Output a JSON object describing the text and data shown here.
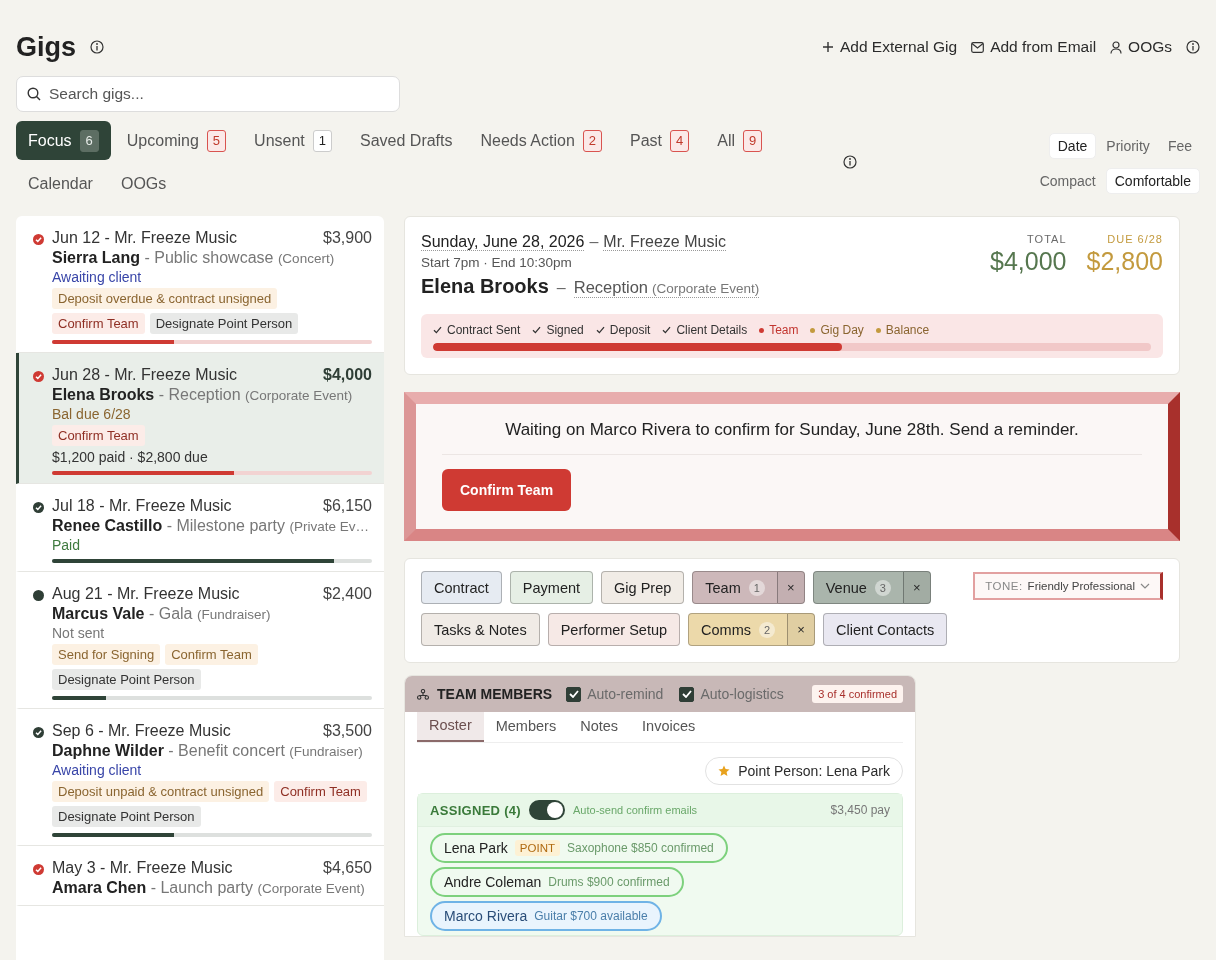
{
  "header": {
    "title": "Gigs",
    "actions": [
      {
        "kind": "add",
        "label": "Add External Gig"
      },
      {
        "kind": "email",
        "label": "Add from Email"
      },
      {
        "kind": "person",
        "label": "OOGs"
      }
    ]
  },
  "search": {
    "placeholder": "Search gigs..."
  },
  "tabs": [
    {
      "label": "Focus",
      "count": {
        "text": "6",
        "kind": "plain"
      },
      "selected": true
    },
    {
      "label": "Upcoming",
      "count": {
        "text": "5",
        "kind": "alert"
      },
      "selected": false
    },
    {
      "label": "Unsent",
      "count": {
        "text": "1",
        "kind": "plain"
      },
      "selected": false
    },
    {
      "label": "Saved Drafts",
      "selected": false
    },
    {
      "label": "Needs Action",
      "count": {
        "text": "2",
        "kind": "alert"
      },
      "selected": false
    },
    {
      "label": "Past",
      "count": {
        "text": "4",
        "kind": "alert"
      },
      "selected": false
    },
    {
      "label": "All",
      "count": {
        "text": "9",
        "kind": "alert"
      },
      "selected": false
    },
    {
      "label": "Calendar",
      "selected": false
    },
    {
      "label": "OOGs",
      "selected": false
    }
  ],
  "sort": [
    {
      "label": "Date",
      "selected": true
    },
    {
      "label": "Priority",
      "selected": false
    },
    {
      "label": "Fee",
      "selected": false
    }
  ],
  "density": [
    {
      "label": "Compact",
      "selected": false
    },
    {
      "label": "Comfortable",
      "selected": true
    }
  ],
  "gigs": [
    {
      "kind": "alert",
      "heading": "Jun 12 - Mr. Freeze Music",
      "amount": "$3,900",
      "name": "Sierra Lang",
      "event": "- Public showcase",
      "category": "(Concert)",
      "status": {
        "text": "Awaiting client",
        "kind": "awaiting"
      },
      "tags": [
        {
          "label": "Deposit overdue & contract unsigned",
          "kind": "warn"
        },
        {
          "label": "Confirm Team",
          "kind": "danger"
        },
        {
          "label": "Designate Point Person",
          "kind": "neutral"
        }
      ],
      "level": 0.38,
      "selected": false
    },
    {
      "kind": "alert",
      "heading": "Jun 28 - Mr. Freeze Music",
      "amount": "$4,000",
      "name": "Elena Brooks",
      "event": "- Reception",
      "category": "(Corporate Event)",
      "status": {
        "text": "Bal due 6/28",
        "kind": "due"
      },
      "tags": [
        {
          "label": "Confirm Team",
          "kind": "danger"
        }
      ],
      "note": "$1,200 paid · $2,800 due",
      "level": 0.57,
      "selected": true
    },
    {
      "kind": "ok",
      "heading": "Jul 18 - Mr. Freeze Music",
      "amount": "$6,150",
      "name": "Renee Castillo",
      "event": "- Milestone party",
      "category": "(Private Ev…",
      "status": {
        "text": "Paid",
        "kind": "paid"
      },
      "level": 0.88,
      "selected": false
    },
    {
      "kind": "idle",
      "heading": "Aug 21 - Mr. Freeze Music",
      "amount": "$2,400",
      "name": "Marcus Vale",
      "event": "- Gala",
      "category": "(Fundraiser)",
      "status": {
        "text": "Not sent",
        "kind": "muted"
      },
      "tags": [
        {
          "label": "Send for Signing",
          "kind": "warn"
        },
        {
          "label": "Confirm Team",
          "kind": "warn"
        },
        {
          "label": "Designate Point Person",
          "kind": "neutral"
        }
      ],
      "level": 0.17,
      "selected": false
    },
    {
      "kind": "ok",
      "heading": "Sep 6 - Mr. Freeze Music",
      "amount": "$3,500",
      "name": "Daphne Wilder",
      "event": "- Benefit concert",
      "category": "(Fundraiser)",
      "status": {
        "text": "Awaiting client",
        "kind": "awaiting"
      },
      "tags": [
        {
          "label": "Deposit unpaid & contract unsigned",
          "kind": "warn"
        },
        {
          "label": "Confirm Team",
          "kind": "danger"
        },
        {
          "label": "Designate Point Person",
          "kind": "neutral"
        }
      ],
      "level": 0.38,
      "selected": false
    },
    {
      "kind": "alert",
      "heading": "May 3 - Mr. Freeze Music",
      "amount": "$4,650",
      "name": "Amara Chen",
      "event": "- Launch party",
      "category": "(Corporate Event)",
      "selected": false
    }
  ],
  "detail": {
    "date": "Sunday, June 28, 2026",
    "date_separator": "–",
    "client": "Mr. Freeze Music",
    "time": "Start 7pm · End 10:30pm",
    "name": "Elena Brooks",
    "name_separator": "–",
    "event": "Reception",
    "category": "(Corporate Event)",
    "totals": [
      {
        "label": "TOTAL",
        "value": "$4,000",
        "kind": "total"
      },
      {
        "label": "DUE 6/28",
        "value": "$2,800",
        "kind": "due"
      }
    ],
    "steps": [
      {
        "label": "Contract Sent",
        "kind": "done"
      },
      {
        "label": "Signed",
        "kind": "done"
      },
      {
        "label": "Deposit",
        "kind": "done"
      },
      {
        "label": "Client Details",
        "kind": "done"
      },
      {
        "label": "Team",
        "kind": "current"
      },
      {
        "label": "Gig Day",
        "kind": "pending"
      },
      {
        "label": "Balance",
        "kind": "pending"
      }
    ],
    "level": 0.57
  },
  "alert": {
    "message": "Waiting on Marco Rivera to confirm for Sunday, June 28th. Send a reminder.",
    "button": "Confirm Team"
  },
  "sections": [
    {
      "label": "Contract",
      "color": "#e6ebf2"
    },
    {
      "label": "Payment",
      "color": "#e6efe5"
    },
    {
      "label": "Gig Prep",
      "color": "#f1ece6"
    },
    {
      "label": "Team",
      "count": "1",
      "close": "×",
      "color": "#cdb8ba"
    },
    {
      "label": "Venue",
      "count": "3",
      "close": "×",
      "color": "#aab5ac"
    },
    {
      "label": "Tasks & Notes",
      "color": "#f0ebe6"
    },
    {
      "label": "Performer Setup",
      "color": "#f6e9e6"
    },
    {
      "label": "Comms",
      "count": "2",
      "close": "×",
      "color": "#ecd9aa"
    },
    {
      "label": "Client Contacts",
      "color": "#e9e8f1"
    }
  ],
  "tone": {
    "label": "TONE:",
    "value": "Friendly Professional"
  },
  "team": {
    "title": "TEAM MEMBERS",
    "options": [
      {
        "label": "Auto-remind",
        "checked": true
      },
      {
        "label": "Auto-logistics",
        "checked": true
      }
    ],
    "confirmed": "3 of 4 confirmed",
    "tabs": [
      {
        "label": "Roster",
        "selected": true
      },
      {
        "label": "Members",
        "selected": false
      },
      {
        "label": "Notes",
        "selected": false
      },
      {
        "label": "Invoices",
        "selected": false
      }
    ],
    "point_person": "Point Person: Lena Park",
    "assigned": {
      "title": "ASSIGNED (4)",
      "auto_send": {
        "label": "Auto-send confirm emails",
        "on": true
      },
      "pay": "$3,450 pay",
      "members": [
        {
          "name": "Lena Park",
          "badge": "POINT",
          "role": "Saxophone",
          "fee": "$850",
          "status": "confirmed",
          "kind": "confirmed"
        },
        {
          "name": "Andre Coleman",
          "role": "Drums",
          "fee": "$900",
          "status": "confirmed",
          "kind": "confirmed"
        },
        {
          "name": "Marco Rivera",
          "role": "Guitar",
          "fee": "$700",
          "status": "available",
          "kind": "available"
        }
      ]
    }
  }
}
